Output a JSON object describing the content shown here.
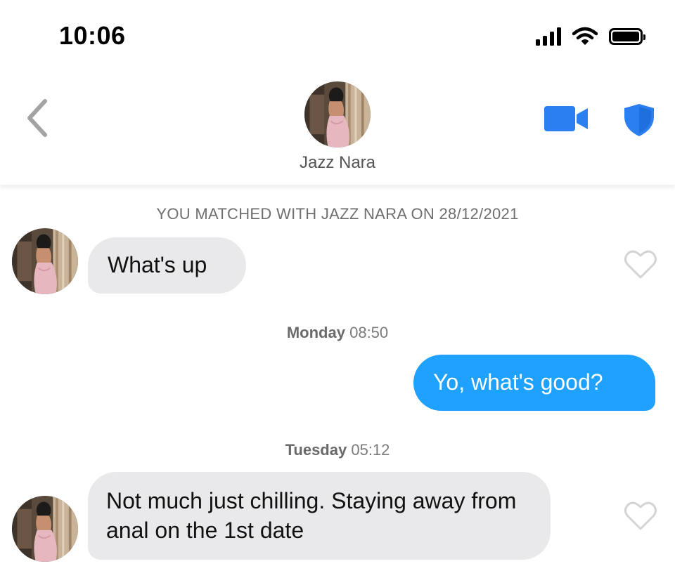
{
  "status_bar": {
    "time": "10:06",
    "icons": [
      "cellular-signal-icon",
      "wifi-icon",
      "battery-icon"
    ]
  },
  "header": {
    "back_icon": "chevron-left-icon",
    "contact_name": "Jazz Nara",
    "video_icon": "video-camera-icon",
    "safety_icon": "shield-icon"
  },
  "chat": {
    "match_banner": "YOU MATCHED WITH JAZZ NARA ON 28/12/2021",
    "messages": [
      {
        "direction": "received",
        "text": "What's up",
        "liked": false
      },
      {
        "direction": "sent",
        "text": "Yo, what's good?"
      },
      {
        "direction": "received",
        "text": "Not much just chilling. Staying away from anal on the 1st date",
        "liked": false
      }
    ],
    "timestamps": [
      {
        "day": "Monday",
        "time": "08:50"
      },
      {
        "day": "Tuesday",
        "time": "05:12"
      }
    ]
  },
  "colors": {
    "accent_blue": "#2b7ff0",
    "sent_bubble": "#1fa2ff",
    "received_bubble": "#e9e9eb",
    "heart_outline": "#d4d4d4"
  }
}
